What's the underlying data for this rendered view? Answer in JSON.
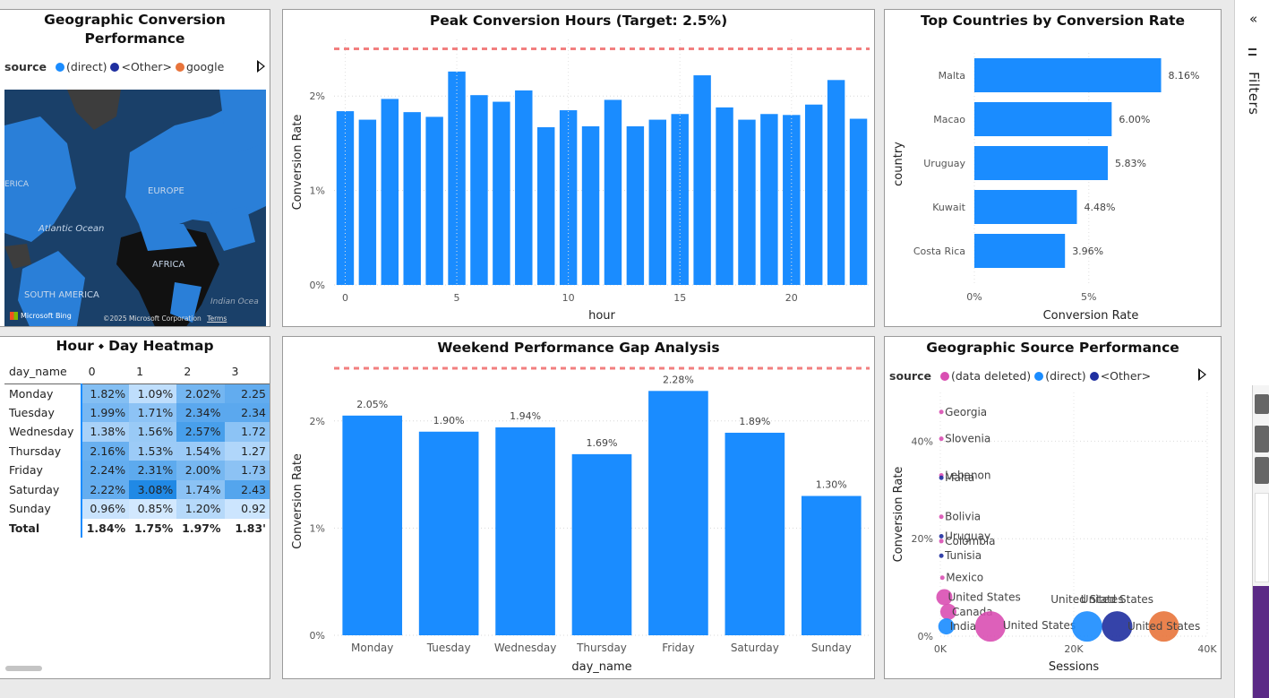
{
  "colors": {
    "bar": "#1a8cff",
    "target_line": "#f27f7f",
    "direct": "#1a8cff",
    "other": "#1f2fa0",
    "google": "#e8743b",
    "data_deleted": "#d94fb2"
  },
  "map_card": {
    "title": "Geographic Conversion Performance",
    "legend_label": "source",
    "legend_items": [
      "(direct)",
      "<Other>",
      "google"
    ],
    "map_labels": {
      "europe": "EUROPE",
      "atlantic": "Atlantic Ocean",
      "africa": "AFRICA",
      "south_america": "SOUTH AMERICA",
      "indian": "Indian Ocea",
      "america": "ERICA"
    },
    "bing": "Microsoft Bing",
    "copyright": "©2025 Microsoft Corporation",
    "terms": "Terms"
  },
  "peak_hours": {
    "title": "Peak Conversion Hours (Target: 2.5%)",
    "chart_data": {
      "type": "bar",
      "title": "Peak Conversion Hours (Target: 2.5%)",
      "xlabel": "hour",
      "ylabel": "Conversion Rate",
      "x": [
        0,
        1,
        2,
        3,
        4,
        5,
        6,
        7,
        8,
        9,
        10,
        11,
        12,
        13,
        14,
        15,
        16,
        17,
        18,
        19,
        20,
        21,
        22,
        23
      ],
      "values": [
        1.84,
        1.75,
        1.97,
        1.83,
        1.78,
        2.26,
        2.01,
        1.94,
        2.06,
        1.67,
        1.85,
        1.68,
        1.96,
        1.68,
        1.75,
        1.81,
        2.22,
        1.88,
        1.75,
        1.81,
        1.8,
        1.91,
        2.17,
        1.76
      ],
      "target": 2.5,
      "ylim": [
        0,
        2.5
      ],
      "yticks": [
        "0%",
        "1%",
        "2%"
      ],
      "xticks": [
        "0",
        "5",
        "10",
        "15",
        "20"
      ],
      "grid": true
    }
  },
  "top_countries": {
    "title": "Top Countries by Conversion Rate",
    "chart_data": {
      "type": "bar",
      "orientation": "horizontal",
      "title": "Top Countries by Conversion Rate",
      "xlabel": "Conversion Rate",
      "ylabel": "country",
      "categories": [
        "Malta",
        "Macao",
        "Uruguay",
        "Kuwait",
        "Costa Rica"
      ],
      "values": [
        8.16,
        6.0,
        5.83,
        4.48,
        3.96
      ],
      "data_labels": [
        "8.16%",
        "6.00%",
        "5.83%",
        "4.48%",
        "3.96%"
      ],
      "xlim": [
        0,
        9
      ],
      "xticks": [
        "0%",
        "5%"
      ]
    }
  },
  "heatmap": {
    "title": "Hour ⬩ Day Heatmap",
    "columns": [
      "day_name",
      "0",
      "1",
      "2",
      "3"
    ],
    "rows": [
      {
        "day": "Monday",
        "values": [
          "1.82%",
          "1.09%",
          "2.02%",
          "2.25"
        ]
      },
      {
        "day": "Tuesday",
        "values": [
          "1.99%",
          "1.71%",
          "2.34%",
          "2.34"
        ]
      },
      {
        "day": "Wednesday",
        "values": [
          "1.38%",
          "1.56%",
          "2.57%",
          "1.72"
        ]
      },
      {
        "day": "Thursday",
        "values": [
          "2.16%",
          "1.53%",
          "1.54%",
          "1.27"
        ]
      },
      {
        "day": "Friday",
        "values": [
          "2.24%",
          "2.31%",
          "2.00%",
          "1.73"
        ]
      },
      {
        "day": "Saturday",
        "values": [
          "2.22%",
          "3.08%",
          "1.74%",
          "2.43"
        ]
      },
      {
        "day": "Sunday",
        "values": [
          "0.96%",
          "0.85%",
          "1.20%",
          "0.92"
        ]
      }
    ],
    "total": {
      "day": "Total",
      "values": [
        "1.84%",
        "1.75%",
        "1.97%",
        "1.83'"
      ]
    },
    "shading": [
      [
        1.82,
        1.09,
        2.02,
        2.25
      ],
      [
        1.99,
        1.71,
        2.34,
        2.34
      ],
      [
        1.38,
        1.56,
        2.57,
        1.72
      ],
      [
        2.16,
        1.53,
        1.54,
        1.27
      ],
      [
        2.24,
        2.31,
        2.0,
        1.73
      ],
      [
        2.22,
        3.08,
        1.74,
        2.43
      ],
      [
        0.96,
        0.85,
        1.2,
        0.92
      ]
    ]
  },
  "weekend_gap": {
    "title": "Weekend Performance Gap Analysis",
    "chart_data": {
      "type": "bar",
      "title": "Weekend Performance Gap Analysis",
      "xlabel": "day_name",
      "ylabel": "Conversion Rate",
      "categories": [
        "Monday",
        "Tuesday",
        "Wednesday",
        "Thursday",
        "Friday",
        "Saturday",
        "Sunday"
      ],
      "values": [
        2.05,
        1.9,
        1.94,
        1.69,
        2.28,
        1.89,
        1.3
      ],
      "data_labels": [
        "2.05%",
        "1.90%",
        "1.94%",
        "1.69%",
        "2.28%",
        "1.89%",
        "1.30%"
      ],
      "target": 2.5,
      "ylim": [
        0,
        2.5
      ],
      "yticks": [
        "0%",
        "1%",
        "2%"
      ]
    }
  },
  "geo_source": {
    "title": "Geographic Source Performance",
    "legend_label": "source",
    "legend_items": [
      "(data deleted)",
      "(direct)",
      "<Other>"
    ],
    "chart_data": {
      "type": "scatter",
      "title": "Geographic Source Performance",
      "xlabel": "Sessions",
      "ylabel": "Conversion Rate",
      "xlim": [
        0,
        40000
      ],
      "ylim": [
        0,
        50
      ],
      "xticks": [
        "0K",
        "20K",
        "40K"
      ],
      "yticks": [
        "0%",
        "20%",
        "40%"
      ],
      "points": [
        {
          "label": "Georgia",
          "x": 150,
          "y": 46,
          "series": "(data deleted)"
        },
        {
          "label": "Slovenia",
          "x": 150,
          "y": 40.5,
          "series": "(data deleted)"
        },
        {
          "label": "Lebanon",
          "x": 150,
          "y": 33,
          "series": "(data deleted)"
        },
        {
          "label": "Malta",
          "x": 150,
          "y": 32.5,
          "series": "<Other>"
        },
        {
          "label": "Bolivia",
          "x": 150,
          "y": 24.5,
          "series": "(data deleted)"
        },
        {
          "label": "Uruguay",
          "x": 150,
          "y": 20.5,
          "series": "<Other>"
        },
        {
          "label": "Colombia",
          "x": 150,
          "y": 19.5,
          "series": "(data deleted)"
        },
        {
          "label": "Tunisia",
          "x": 150,
          "y": 16.5,
          "series": "<Other>"
        },
        {
          "label": "Mexico",
          "x": 300,
          "y": 12,
          "series": "(data deleted)"
        },
        {
          "label": "United States",
          "x": 600,
          "y": 8,
          "series": "(data deleted)"
        },
        {
          "label": "Canada",
          "x": 1200,
          "y": 5,
          "series": "(data deleted)"
        },
        {
          "label": "India",
          "x": 900,
          "y": 2,
          "series": "(direct)"
        },
        {
          "label": "United States",
          "x": 7500,
          "y": 2,
          "series": "(data deleted)"
        },
        {
          "label": "United States",
          "x": 22000,
          "y": 2,
          "series": "(direct)"
        },
        {
          "label": "United States",
          "x": 26500,
          "y": 2,
          "series": "<Other>"
        },
        {
          "label": "United States",
          "x": 33500,
          "y": 2,
          "series": "google"
        }
      ]
    }
  },
  "filters_pane": {
    "label": "Filters",
    "collapse_icon": "«"
  }
}
